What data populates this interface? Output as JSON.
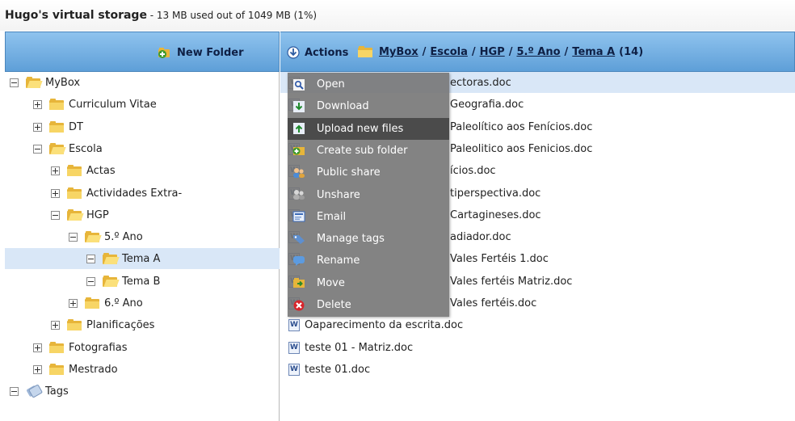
{
  "title": {
    "name": "Hugo's virtual storage",
    "usage": " - 13 MB used out of 1049 MB (1%)"
  },
  "toolbar": {
    "new_folder": "New Folder",
    "actions": "Actions"
  },
  "breadcrumb": {
    "items": [
      "MyBox",
      "Escola",
      "HGP",
      "5.º Ano",
      "Tema A"
    ],
    "separator": "/",
    "count": "(14)"
  },
  "tree": [
    {
      "label": "MyBox",
      "expander": "minus",
      "icon": "folder-open-icon"
    },
    {
      "label": "Curriculum Vitae",
      "expander": "plus",
      "icon": "folder-icon"
    },
    {
      "label": "DT",
      "expander": "plus",
      "icon": "folder-icon"
    },
    {
      "label": "Escola",
      "expander": "minus",
      "icon": "folder-open-icon"
    },
    {
      "label": "Actas",
      "expander": "plus",
      "icon": "folder-icon"
    },
    {
      "label": "Actividades Extra-",
      "expander": "plus",
      "icon": "folder-icon"
    },
    {
      "label": "HGP",
      "expander": "minus",
      "icon": "folder-open-icon"
    },
    {
      "label": "5.º Ano",
      "expander": "minus",
      "icon": "folder-open-icon"
    },
    {
      "label": "Tema A",
      "expander": "minus",
      "icon": "folder-open-icon"
    },
    {
      "label": "Tema B",
      "expander": "minus",
      "icon": "folder-open-icon"
    },
    {
      "label": "6.º Ano",
      "expander": "plus",
      "icon": "folder-icon"
    },
    {
      "label": "Planificações",
      "expander": "plus",
      "icon": "folder-icon"
    },
    {
      "label": "Fotografias",
      "expander": "plus",
      "icon": "folder-icon"
    },
    {
      "label": "Mestrado",
      "expander": "plus",
      "icon": "folder-icon"
    },
    {
      "label": "Tags",
      "expander": "minus",
      "icon": "tags-icon"
    }
  ],
  "files": [
    "ectoras.doc",
    "Geografia.doc",
    "Paleolítico aos Fenícios.doc",
    "Paleolitico aos Fenicios.doc",
    "ícios.doc",
    "tiperspectiva.doc",
    "Cartagineses.doc",
    "adiador.doc",
    "Vales Fertéis 1.doc",
    "Vales fertéis Matriz.doc",
    "Vales fertéis.doc",
    "Oaparecimento da escrita.doc",
    "teste 01 - Matriz.doc",
    "teste 01.doc"
  ],
  "context_menu": [
    {
      "label": "Open",
      "icon": "magnifier-icon"
    },
    {
      "label": "Download",
      "icon": "download-icon"
    },
    {
      "label": "Upload new files",
      "icon": "upload-icon"
    },
    {
      "label": "Create sub folder",
      "icon": "add-folder-icon"
    },
    {
      "label": "Public share",
      "icon": "users-icon"
    },
    {
      "label": "Unshare",
      "icon": "users-gray-icon"
    },
    {
      "label": "Email",
      "icon": "email-icon"
    },
    {
      "label": "Manage tags",
      "icon": "tag-icon"
    },
    {
      "label": "Rename",
      "icon": "speech-bubble-icon"
    },
    {
      "label": "Move",
      "icon": "move-folder-icon"
    },
    {
      "label": "Delete",
      "icon": "delete-x-icon"
    }
  ],
  "colors": {
    "header_gradient_top": "#8fc3ee",
    "header_gradient_bottom": "#5e9fd8",
    "selection": "#d9e7f7",
    "menu_bg": "#767676",
    "menu_hover": "#484848"
  }
}
